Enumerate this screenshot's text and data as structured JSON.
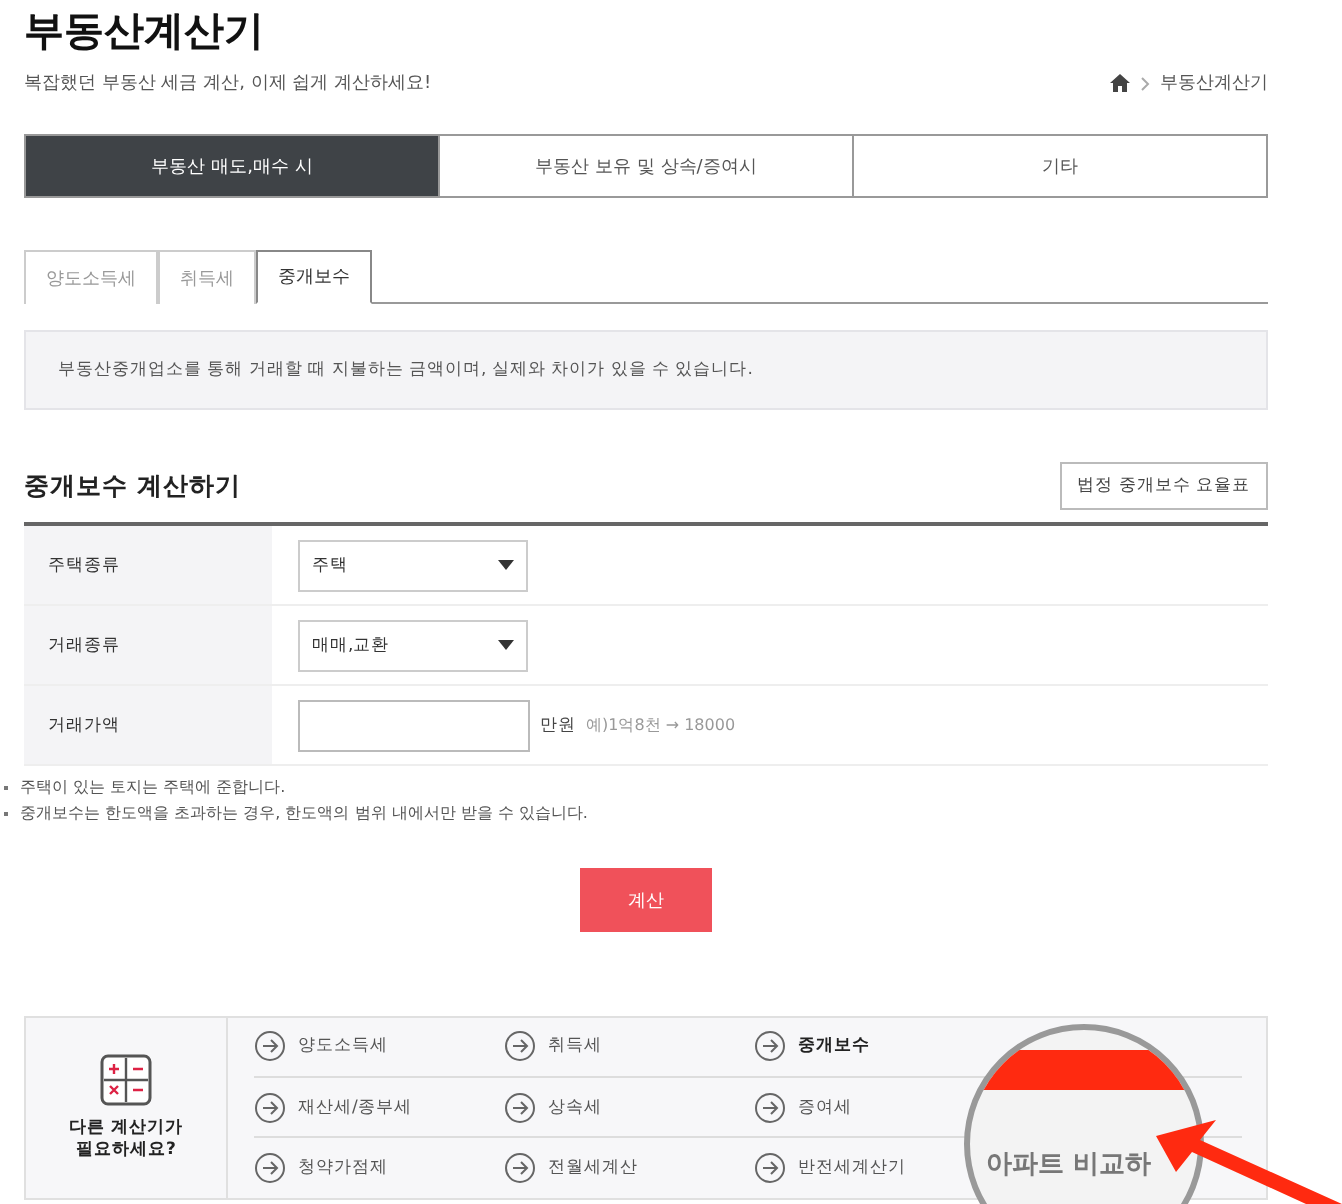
{
  "header": {
    "title": "부동산계산기",
    "subtitle": "복잡했던 부동산 세금 계산, 이제 쉽게 계산하세요!",
    "breadcrumb": "부동산계산기"
  },
  "main_tabs": [
    {
      "label": "부동산 매도,매수 시",
      "selected": true
    },
    {
      "label": "부동산 보유 및 상속/증여시",
      "selected": false
    },
    {
      "label": "기타",
      "selected": false
    }
  ],
  "sub_tabs": [
    {
      "label": "양도소득세",
      "selected": false
    },
    {
      "label": "취득세",
      "selected": false
    },
    {
      "label": "중개보수",
      "selected": true
    }
  ],
  "notice": "부동산중개업소를 통해 거래할 때 지불하는 금액이며, 실제와 차이가 있을 수 있습니다.",
  "section": {
    "title": "중개보수 계산하기",
    "rate_button": "법정 중개보수 요율표"
  },
  "form": [
    {
      "kind": "select",
      "label": "주택종류",
      "value": "주택"
    },
    {
      "kind": "select",
      "label": "거래종류",
      "value": "매매,교환"
    },
    {
      "kind": "amount",
      "label": "거래가액",
      "unit": "만원",
      "hint": "예)1억8천 → 18000"
    }
  ],
  "notes": [
    "주택이 있는 토지는 주택에 준합니다.",
    "중개보수는 한도액을 초과하는 경우, 한도액의 범위 내에서만 받을 수 있습니다."
  ],
  "submit": "계산",
  "other": {
    "title": "다른 계산기가 필요하세요?",
    "links": [
      {
        "label": "양도소득세",
        "selected": false
      },
      {
        "label": "취득세",
        "selected": false
      },
      {
        "label": "중개보수",
        "selected": true
      },
      {
        "label": "재산세/종부세",
        "selected": false
      },
      {
        "label": "상속세",
        "selected": false
      },
      {
        "label": "증여세",
        "selected": false
      },
      {
        "label": "청약가점제",
        "selected": false
      },
      {
        "label": "전월세계산",
        "selected": false
      },
      {
        "label": "반전세계산기",
        "selected": false
      }
    ]
  },
  "magnifier": {
    "text": "아파트 비교하"
  }
}
